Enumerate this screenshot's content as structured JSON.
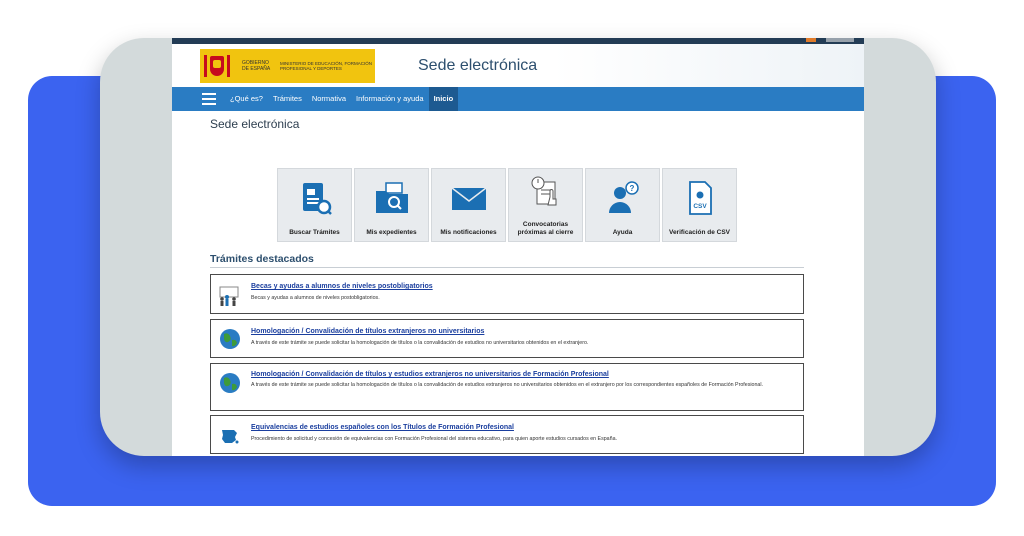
{
  "site": {
    "ministry_gobierno": "GOBIERNO DE ESPAÑA",
    "ministry_name": "MINISTERIO DE EDUCACIÓN, FORMACIÓN PROFESIONAL Y DEPORTES",
    "header_title": "Sede electrónica"
  },
  "nav": {
    "items": [
      {
        "label": "¿Qué es?"
      },
      {
        "label": "Trámites"
      },
      {
        "label": "Normativa"
      },
      {
        "label": "Información y ayuda"
      },
      {
        "label": "Inicio"
      }
    ]
  },
  "page": {
    "heading": "Sede electrónica",
    "section_title": "Trámites destacados"
  },
  "tiles": [
    {
      "label": "Buscar Trámites",
      "icon": "search-document-icon"
    },
    {
      "label": "Mis expedientes",
      "icon": "folder-search-icon"
    },
    {
      "label": "Mis notificaciones",
      "icon": "envelope-icon"
    },
    {
      "label": "Convocatorias próximas al cierre",
      "icon": "clock-document-icon"
    },
    {
      "label": "Ayuda",
      "icon": "user-help-icon"
    },
    {
      "label": "Verificación de CSV",
      "icon": "csv-document-icon"
    }
  ],
  "tramites": [
    {
      "title": "Becas y ayudas a alumnos de niveles postobligatorios",
      "desc": "Becas y ayudas a alumnos de niveles postobligatorios.",
      "icon": "students-icon"
    },
    {
      "title": "Homologación / Convalidación de títulos extranjeros no universitarios",
      "desc": "A través de este trámite se puede solicitar la homologación de títulos o la convalidación de estudios no universitarios obtenidos en el extranjero.",
      "icon": "globe-icon"
    },
    {
      "title": "Homologación / Convalidación de títulos y estudios extranjeros no universitarios de Formación Profesional",
      "desc": "A través de este trámite se puede solicitar la homologación de títulos o la convalidación de estudios extranjeros no universitarios obtenidos en el extranjero por los correspondientes españoles de Formación Profesional.",
      "icon": "globe-icon"
    },
    {
      "title": "Equivalencias de estudios españoles con los Títulos de Formación Profesional",
      "desc": "Procedimiento de solicitud y concesión de equivalencias con Formación Profesional del sistema educativo, para quien aporte estudios cursados en España.",
      "icon": "spain-map-icon"
    }
  ]
}
